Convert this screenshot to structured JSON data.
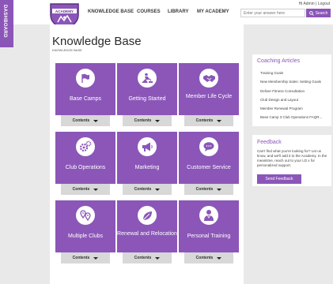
{
  "sidebar_tab": {
    "label": "DASHBOARD"
  },
  "logo": {
    "text": "ACADEMY"
  },
  "nav": {
    "items": [
      "KNOWLEDGE BASE",
      "COURSES",
      "LIBRARY",
      "MY ACADEMY"
    ]
  },
  "user": {
    "greeting": "Hi Admin | Logout"
  },
  "search": {
    "placeholder": "Enter your answer here",
    "button_label": "Search"
  },
  "page": {
    "title": "Knowledge Base",
    "breadcrumb": "KNOWLEDGE BASE"
  },
  "cards": [
    {
      "label": "Base Camps",
      "icon": "flag-icon",
      "contents_label": "Contents"
    },
    {
      "label": "Getting Started",
      "icon": "construction-icon",
      "contents_label": "Contents"
    },
    {
      "label": "Member Life Cycle",
      "icon": "handshake-icon",
      "contents_label": "Contents"
    },
    {
      "label": "Club Operations",
      "icon": "gears-icon",
      "contents_label": "Contents"
    },
    {
      "label": "Marketing",
      "icon": "megaphone-icon",
      "contents_label": "Contents"
    },
    {
      "label": "Customer Service",
      "icon": "chat-icon",
      "contents_label": "Contents"
    },
    {
      "label": "Multiple Clubs",
      "icon": "location-pins-icon",
      "contents_label": "Contents"
    },
    {
      "label": "Renewal and Relocation",
      "icon": "leaf-icon",
      "contents_label": "Contents"
    },
    {
      "label": "Personal Training",
      "icon": "trainer-icon",
      "contents_label": "Contents"
    }
  ],
  "coaching": {
    "title": "Coaching Articles",
    "links": [
      "Training Goals",
      "New Membership Sales: Setting Goals",
      "Deliver Fitness Consultation",
      "Club Design and Layout",
      "Member Renewal Program",
      "Base Camp 3 Club Operations FAQR..."
    ]
  },
  "feedback": {
    "title": "Feedback",
    "text": "Can't find what you're looking for? Let us know, and we'll add it to the Academy. In the meantime, reach out to your LD x for personalized support.",
    "button_label": "Send Feedback"
  },
  "colors": {
    "accent": "#8b56b8",
    "contents_bg": "#d8d8d8",
    "page_bg": "#e9e9e9"
  }
}
